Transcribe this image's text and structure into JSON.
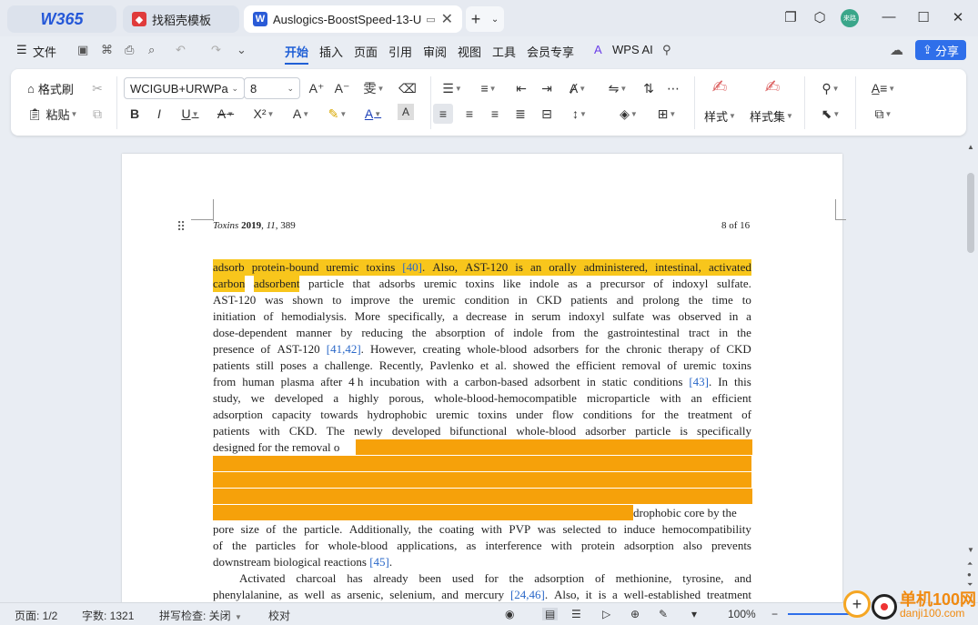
{
  "tabs": {
    "logo": "W365",
    "template": "找稻壳模板",
    "document": "Auslogics-BoostSpeed-13-U",
    "close": "✕",
    "new": "+"
  },
  "window": {
    "avatar": "来路"
  },
  "menu": {
    "file": "文件",
    "items": [
      "开始",
      "插入",
      "页面",
      "引用",
      "审阅",
      "视图",
      "工具",
      "会员专享"
    ],
    "wps_ai": "WPS AI",
    "share": "分享"
  },
  "ribbon": {
    "format_painter": "格式刷",
    "paste": "粘贴",
    "font_name": "WCIGUB+URWPa",
    "font_size": "8",
    "styles": "样式",
    "style_set": "样式集"
  },
  "document": {
    "header_journal": "Toxins",
    "header_year": "2019",
    "header_volume": "11",
    "header_page": "389",
    "page_of": "8 of 16",
    "lines": [
      [
        "adsorb",
        "protein-bound",
        "uremic",
        "toxins",
        "[40].",
        "Also,",
        "AST-120",
        "is",
        "an",
        "orally",
        "administered,",
        "intestinal,",
        "activated"
      ],
      [
        "carbon",
        "adsorbent",
        "particle",
        "that",
        "adsorbs",
        "uremic",
        "toxins",
        "like",
        "indole",
        "as",
        "a",
        "precursor",
        "of",
        "indoxyl",
        "sulfate."
      ],
      [
        "AST-120",
        "was",
        "shown",
        "to",
        "improve",
        "the",
        "uremic",
        "condition",
        "in",
        "CKD",
        "patients",
        "and",
        "prolong",
        "the",
        "time",
        "to"
      ],
      [
        "initiation",
        "of",
        "hemodialysis.",
        "More",
        "specifically,",
        "a",
        "decrease",
        "in",
        "serum",
        "indoxyl",
        "sulfate",
        "was",
        "observed",
        "in",
        "a"
      ],
      [
        "dose-dependent",
        "manner",
        "by",
        "reducing",
        "the",
        "absorption",
        "of",
        "indole",
        "from",
        "the",
        "gastrointestinal",
        "tract",
        "in",
        "the"
      ],
      [
        "presence",
        "of",
        "AST-120",
        "[41,42].",
        "However,",
        "creating",
        "whole-blood",
        "adsorbers",
        "for",
        "the",
        "chronic",
        "therapy",
        "of",
        "CKD"
      ],
      [
        "patients",
        "still",
        "poses",
        "a",
        "challenge.",
        "Recently,",
        "Pavlenko",
        "et",
        "al.",
        "showed",
        "the",
        "efficient",
        "removal",
        "of",
        "uremic",
        "toxins"
      ],
      [
        "from",
        "human",
        "plasma",
        "after",
        "4 h",
        "incubation",
        "with",
        "a",
        "carbon-based",
        "adsorbent",
        "in",
        "static",
        "conditions",
        "[43].",
        "In",
        "this"
      ],
      [
        "study,",
        "we",
        "developed",
        "a",
        "highly",
        "porous,",
        "whole-blood-hemocompatible",
        "microparticle",
        "with",
        "an",
        "efficient"
      ],
      [
        "adsorption",
        "capacity",
        "towards",
        "hydrophobic",
        "uremic",
        "toxins",
        "under",
        "flow",
        "conditions",
        "for",
        "the",
        "treatment",
        "of"
      ],
      [
        "patients",
        "with",
        "CKD.",
        "The",
        "newly",
        "developed",
        "bifunctional",
        "whole-blood",
        "adsorber",
        "particle",
        "is",
        "specifically"
      ],
      [
        "designed for the removal o"
      ],
      [],
      [],
      [],
      [
        "drophobic core by the"
      ],
      [
        "pore",
        "size",
        "of",
        "the",
        "particle.",
        "Additionally,",
        "the",
        "coating",
        "with",
        "PVP",
        "was",
        "selected",
        "to",
        "induce",
        "hemocompatibility"
      ],
      [
        "of",
        "the",
        "particles",
        "for",
        "whole-blood",
        "applications,",
        "as",
        "interference",
        "with",
        "protein",
        "adsorption",
        "also",
        "prevents"
      ],
      [
        "downstream biological reactions [45]."
      ],
      [
        "Activated",
        "charcoal",
        "has",
        "already",
        "been",
        "used",
        "for",
        "the",
        "adsorption",
        "of",
        "methionine,",
        "tyrosine,",
        "and"
      ],
      [
        "phenylalanine,",
        "as",
        "well",
        "as",
        "arsenic,",
        "selenium,",
        "and",
        "mercury",
        "[24,46].",
        "Also,",
        "it",
        "is",
        "a",
        "well-established",
        "treatment"
      ]
    ]
  },
  "status": {
    "page": "页面: 1/2",
    "words": "字数: 1321",
    "spell": "拼写检查: 关闭",
    "proof": "校对",
    "zoom": "100%"
  },
  "watermark": {
    "title": "单机100网",
    "url": "danji100.com"
  },
  "colors": {
    "accent": "#1f5fd6",
    "highlight_yellow": "#f8c61c",
    "highlight_orange": "#f6a10a",
    "citation": "#2a68c8"
  }
}
